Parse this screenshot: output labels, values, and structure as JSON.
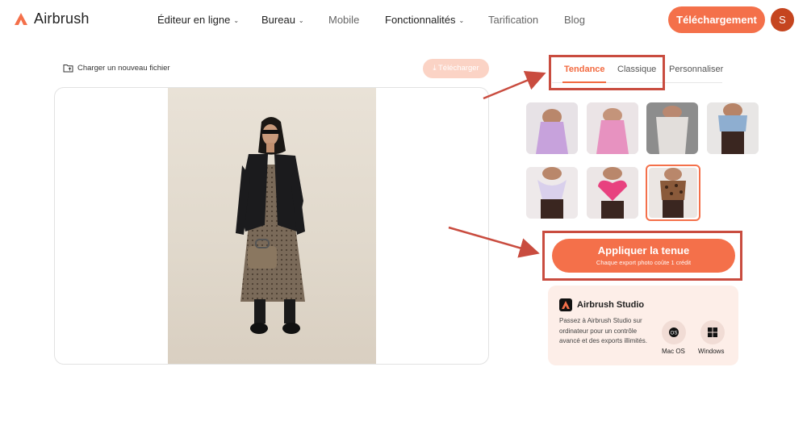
{
  "header": {
    "logo_text": "Airbrush",
    "menu": [
      {
        "label": "Éditeur en ligne",
        "has_dropdown": true
      },
      {
        "label": "Bureau",
        "has_dropdown": true
      },
      {
        "label": "Mobile",
        "has_dropdown": false
      },
      {
        "label": "Fonctionnalités",
        "has_dropdown": true
      },
      {
        "label": "Tarification",
        "has_dropdown": false
      },
      {
        "label": "Blog",
        "has_dropdown": false
      }
    ],
    "download_label": "Téléchargement",
    "avatar_initial": "S"
  },
  "editor": {
    "upload_label": "Charger un nouveau fichier",
    "download_label": "Télécharger"
  },
  "outfits": {
    "tabs": [
      {
        "label": "Tendance",
        "active": true
      },
      {
        "label": "Classique",
        "active": false
      },
      {
        "label": "Personnaliser",
        "active": false
      }
    ],
    "items": [
      {
        "name": "lilac-slip-dress",
        "color": "#c7a2dc",
        "selected": false
      },
      {
        "name": "pink-satin-dress",
        "color": "#e792c0",
        "selected": false
      },
      {
        "name": "white-lace-dress",
        "color": "#d9d6d3",
        "selected": false
      },
      {
        "name": "denim-bow-top",
        "color": "#8eaed0",
        "selected": false
      },
      {
        "name": "butterfly-top",
        "color": "#d9d0ec",
        "selected": false
      },
      {
        "name": "pink-heart-top",
        "color": "#e8417f",
        "selected": false
      },
      {
        "name": "leopard-cami",
        "color": "#8a5a3a",
        "selected": true
      }
    ],
    "apply_label": "Appliquer la tenue",
    "apply_sub": "Chaque export photo coûte 1 crédit"
  },
  "studio": {
    "title": "Airbrush Studio",
    "description": "Passez à Airbrush Studio sur ordinateur pour un contrôle avancé et des exports illimités.",
    "platforms": [
      {
        "label": "Mac OS",
        "icon": "apple-icon"
      },
      {
        "label": "Windows",
        "icon": "windows-icon"
      }
    ]
  },
  "colors": {
    "accent": "#f4704a",
    "highlight": "#c94c3f"
  }
}
